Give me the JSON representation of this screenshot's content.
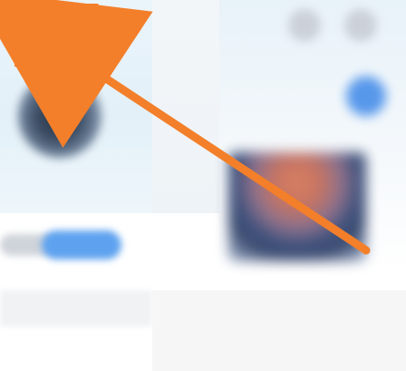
{
  "screen": {
    "left_panel": {
      "settings_button": {
        "icon": "gear-icon"
      },
      "avatar": {
        "icon": "avatar"
      }
    },
    "right_panel": {
      "fab": {
        "icon": "action-icon"
      }
    }
  },
  "annotation": {
    "color": "#f37f2a"
  }
}
